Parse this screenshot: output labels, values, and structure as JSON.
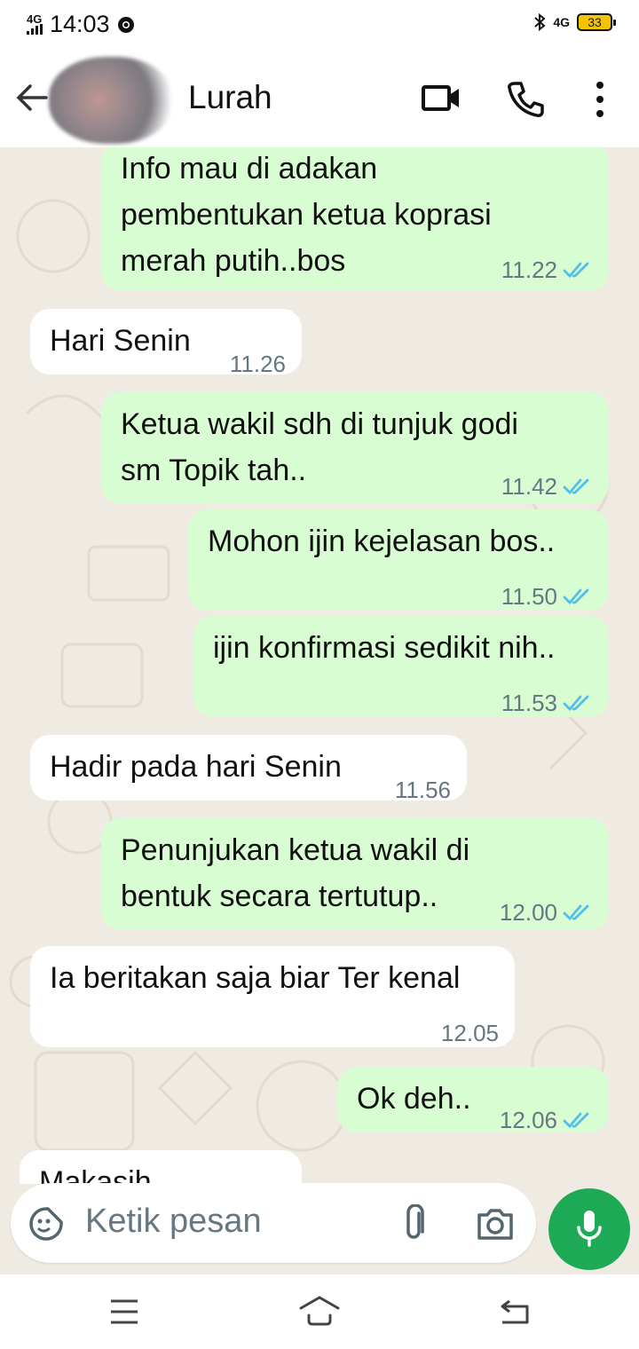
{
  "status_bar": {
    "network_left": "4G",
    "time": "14:03",
    "network_right": "4G",
    "battery": "33"
  },
  "header": {
    "contact_name": "Lurah",
    "icons": [
      "back-arrow-icon",
      "avatar",
      "video-call-icon",
      "voice-call-icon",
      "more-vert-icon"
    ]
  },
  "messages": [
    {
      "dir": "out",
      "lines": [
        "Info mau di adakan",
        "pembentukan ketua koprasi",
        "merah putih..bos"
      ],
      "time": "11.22",
      "read": true
    },
    {
      "dir": "in",
      "lines": [
        "Hari Senin"
      ],
      "time": "11.26"
    },
    {
      "dir": "out",
      "lines": [
        "Ketua wakil sdh di tunjuk godi",
        "sm Topik tah.."
      ],
      "time": "11.42",
      "read": true
    },
    {
      "dir": "out",
      "lines": [
        "Mohon ijin kejelasan bos.."
      ],
      "time": "11.50",
      "read": true
    },
    {
      "dir": "out",
      "lines": [
        "ijin konfirmasi sedikit nih.."
      ],
      "time": "11.53",
      "read": true
    },
    {
      "dir": "in",
      "lines": [
        "Hadir pada hari Senin"
      ],
      "time": "11.56"
    },
    {
      "dir": "out",
      "lines": [
        "Penunjukan ketua wakil di",
        "bentuk secara tertutup.."
      ],
      "time": "12.00",
      "read": true
    },
    {
      "dir": "in",
      "lines": [
        "Ia beritakan saja biar Ter kenal"
      ],
      "time": "12.05"
    },
    {
      "dir": "out",
      "lines": [
        "Ok deh.."
      ],
      "time": "12.06",
      "read": true
    },
    {
      "dir": "in",
      "lines": [
        "Makasih"
      ],
      "time": "",
      "partial": true
    }
  ],
  "input": {
    "placeholder": "Ketik pesan",
    "icons": [
      "emoji-sticker-icon",
      "attach-icon",
      "camera-icon",
      "mic-icon"
    ]
  },
  "nav": {
    "icons": [
      "menu-icon",
      "home-icon",
      "back-icon"
    ]
  },
  "colors": {
    "outgoing_bubble": "#d9fdd3",
    "incoming_bubble": "#ffffff",
    "wallpaper": "#efeae2",
    "read_tick": "#53bdeb",
    "mic_button": "#1da955"
  }
}
